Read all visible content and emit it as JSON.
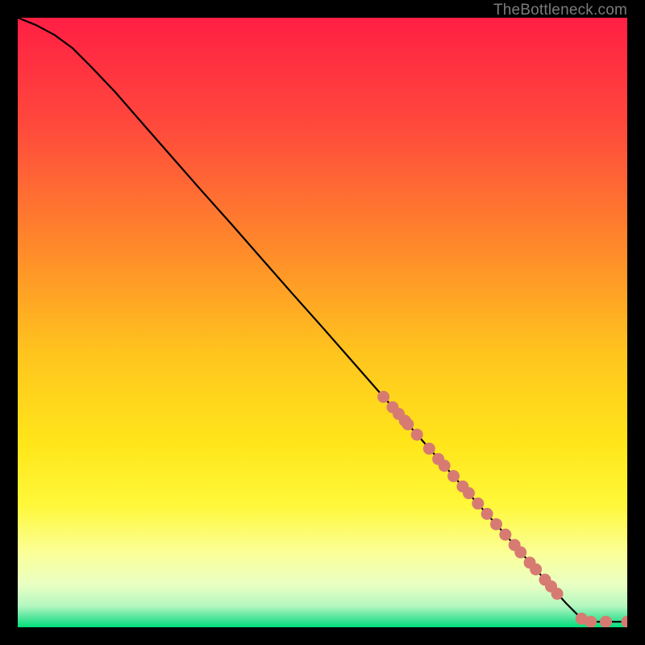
{
  "watermark": "TheBottleneck.com",
  "chart_data": {
    "type": "line",
    "title": "",
    "xlabel": "",
    "ylabel": "",
    "xlim": [
      0,
      100
    ],
    "ylim": [
      0,
      100
    ],
    "grid": false,
    "legend": false,
    "background_gradient": {
      "stops": [
        {
          "offset": 0.0,
          "color": "#ff1f44"
        },
        {
          "offset": 0.18,
          "color": "#ff4a3c"
        },
        {
          "offset": 0.38,
          "color": "#ff8a2a"
        },
        {
          "offset": 0.55,
          "color": "#ffc41e"
        },
        {
          "offset": 0.7,
          "color": "#ffe61a"
        },
        {
          "offset": 0.8,
          "color": "#fff83a"
        },
        {
          "offset": 0.88,
          "color": "#fbff9a"
        },
        {
          "offset": 0.93,
          "color": "#e9ffc2"
        },
        {
          "offset": 0.965,
          "color": "#b4f7c0"
        },
        {
          "offset": 0.985,
          "color": "#4fe59a"
        },
        {
          "offset": 1.0,
          "color": "#00e07a"
        }
      ]
    },
    "series": [
      {
        "name": "curve",
        "type": "line",
        "x": [
          0,
          3,
          6,
          9,
          12,
          16,
          20,
          25,
          30,
          35,
          40,
          45,
          50,
          55,
          60,
          65,
          70,
          75,
          80,
          85,
          88,
          90,
          92.5,
          94,
          96.5,
          100
        ],
        "y": [
          100,
          98.8,
          97.2,
          95.0,
          92.0,
          87.8,
          83.2,
          77.5,
          71.8,
          66.2,
          60.5,
          54.8,
          49.2,
          43.5,
          37.8,
          32.2,
          26.5,
          20.8,
          15.2,
          9.5,
          6.1,
          3.9,
          1.4,
          0.9,
          0.9,
          0.9
        ]
      },
      {
        "name": "markers",
        "type": "scatter",
        "color": "#d77b72",
        "x": [
          60.0,
          61.5,
          62.5,
          63.5,
          64.0,
          65.5,
          67.5,
          69.0,
          70.0,
          71.5,
          73.0,
          74.0,
          75.5,
          77.0,
          78.5,
          80.0,
          81.5,
          82.5,
          84.0,
          85.0,
          86.5,
          87.5,
          88.5,
          92.5,
          94.0,
          96.5,
          100.0
        ],
        "y": [
          37.8,
          36.1,
          35.0,
          33.9,
          33.3,
          31.6,
          29.3,
          27.6,
          26.5,
          24.8,
          23.1,
          22.0,
          20.3,
          18.6,
          16.9,
          15.2,
          13.5,
          12.3,
          10.6,
          9.5,
          7.8,
          6.7,
          5.5,
          1.4,
          0.9,
          0.9,
          0.9
        ]
      }
    ]
  }
}
